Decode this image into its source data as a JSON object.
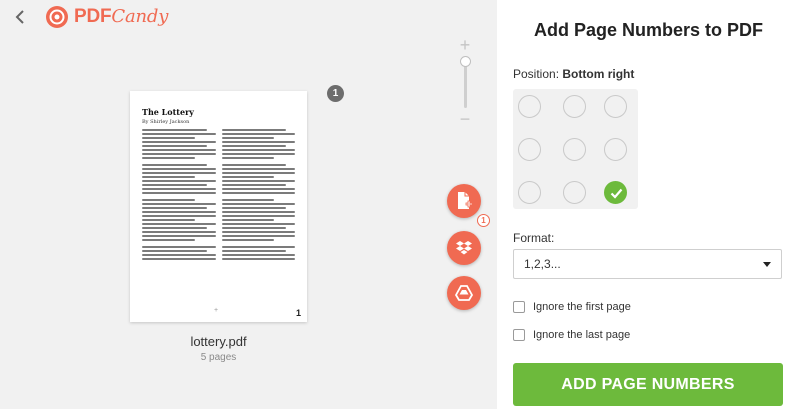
{
  "app": {
    "logo_pdf": "PDF",
    "logo_candy": "Candy"
  },
  "icons": {
    "back": "chevron-left-icon",
    "logo": "candy-logo-icon",
    "add_file": "file-add-icon",
    "dropbox": "dropbox-icon",
    "drive": "google-drive-icon",
    "check": "checkmark-icon"
  },
  "colors": {
    "brand": "#f06a52",
    "accent_green": "#6dba3c",
    "workspace_bg": "#f1f1f1"
  },
  "workspace": {
    "zoom_plus": "+",
    "zoom_minus": "−",
    "zoom_level": 0.0,
    "page_badge": "1",
    "file": {
      "name": "lottery.pdf",
      "pages_label": "5 pages"
    },
    "preview": {
      "title": "The Lottery",
      "author": "By Shirley Jackson",
      "page_number": "1",
      "corner_mark": "+"
    },
    "fab_count": "1"
  },
  "panel": {
    "title": "Add Page Numbers to PDF",
    "position_label": "Position:",
    "position_value": "Bottom right",
    "positions": [
      "top-left",
      "top-center",
      "top-right",
      "middle-left",
      "middle-center",
      "middle-right",
      "bottom-left",
      "bottom-center",
      "bottom-right"
    ],
    "selected_position": "bottom-right",
    "format_label": "Format:",
    "format_value": "1,2,3...",
    "ignore_first": {
      "label": "Ignore the first page",
      "checked": false
    },
    "ignore_last": {
      "label": "Ignore the last page",
      "checked": false
    },
    "submit_label": "ADD PAGE NUMBERS"
  }
}
